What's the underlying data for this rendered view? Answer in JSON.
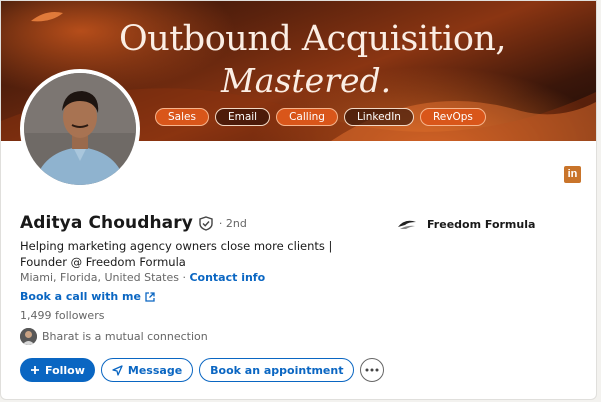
{
  "banner": {
    "line1": "Outbound Acquisition,",
    "line2": "Mastered.",
    "chips": [
      {
        "label": "Sales",
        "style": "filled"
      },
      {
        "label": "Email",
        "style": "outline"
      },
      {
        "label": "Calling",
        "style": "filled"
      },
      {
        "label": "LinkedIn",
        "style": "outline"
      },
      {
        "label": "RevOps",
        "style": "filled"
      }
    ]
  },
  "profile": {
    "name": "Aditya Choudhary",
    "degree": "· 2nd",
    "headline": "Helping marketing agency owners close more clients | Founder @ Freedom Formula",
    "location": "Miami, Florida, United States",
    "contact_sep": " · ",
    "contact_info": "Contact info",
    "book_link": "Book a call with me",
    "followers": "1,499 followers",
    "mutual": "Bharat is a mutual connection",
    "company": "Freedom Formula"
  },
  "badge": {
    "label": "in"
  },
  "actions": {
    "follow": "Follow",
    "message": "Message",
    "book": "Book an appointment"
  },
  "colors": {
    "primary": "#0a66c2",
    "accent": "#d9561a"
  }
}
